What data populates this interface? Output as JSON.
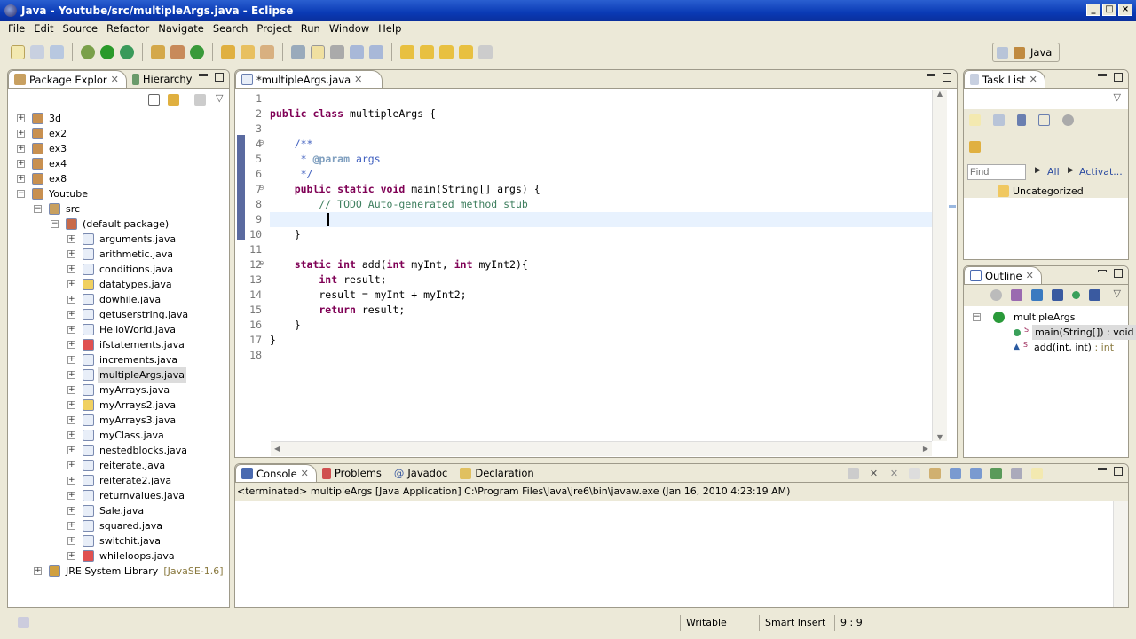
{
  "window": {
    "title": "Java - Youtube/src/multipleArgs.java - Eclipse"
  },
  "menu": [
    "File",
    "Edit",
    "Source",
    "Refactor",
    "Navigate",
    "Search",
    "Project",
    "Run",
    "Window",
    "Help"
  ],
  "perspective": {
    "label": "Java"
  },
  "left_panel": {
    "tabs": [
      "Package Explor",
      "Hierarchy"
    ],
    "tree": [
      {
        "label": "3d",
        "level": 0,
        "exp": "+",
        "icon": "project"
      },
      {
        "label": "ex2",
        "level": 0,
        "exp": "+",
        "icon": "project"
      },
      {
        "label": "ex3",
        "level": 0,
        "exp": "+",
        "icon": "project"
      },
      {
        "label": "ex4",
        "level": 0,
        "exp": "+",
        "icon": "project"
      },
      {
        "label": "ex8",
        "level": 0,
        "exp": "+",
        "icon": "project"
      },
      {
        "label": "Youtube",
        "level": 0,
        "exp": "-",
        "icon": "project"
      },
      {
        "label": "src",
        "level": 1,
        "exp": "-",
        "icon": "src"
      },
      {
        "label": "(default package)",
        "level": 2,
        "exp": "-",
        "icon": "package"
      },
      {
        "label": "arguments.java",
        "level": 3,
        "exp": "+",
        "icon": "java"
      },
      {
        "label": "arithmetic.java",
        "level": 3,
        "exp": "+",
        "icon": "java"
      },
      {
        "label": "conditions.java",
        "level": 3,
        "exp": "+",
        "icon": "java"
      },
      {
        "label": "datatypes.java",
        "level": 3,
        "exp": "+",
        "icon": "java-warn"
      },
      {
        "label": "dowhile.java",
        "level": 3,
        "exp": "+",
        "icon": "java"
      },
      {
        "label": "getuserstring.java",
        "level": 3,
        "exp": "+",
        "icon": "java"
      },
      {
        "label": "HelloWorld.java",
        "level": 3,
        "exp": "+",
        "icon": "java"
      },
      {
        "label": "ifstatements.java",
        "level": 3,
        "exp": "+",
        "icon": "java-error"
      },
      {
        "label": "increments.java",
        "level": 3,
        "exp": "+",
        "icon": "java"
      },
      {
        "label": "multipleArgs.java",
        "level": 3,
        "exp": "+",
        "icon": "java",
        "selected": true
      },
      {
        "label": "myArrays.java",
        "level": 3,
        "exp": "+",
        "icon": "java"
      },
      {
        "label": "myArrays2.java",
        "level": 3,
        "exp": "+",
        "icon": "java-warn"
      },
      {
        "label": "myArrays3.java",
        "level": 3,
        "exp": "+",
        "icon": "java"
      },
      {
        "label": "myClass.java",
        "level": 3,
        "exp": "+",
        "icon": "java"
      },
      {
        "label": "nestedblocks.java",
        "level": 3,
        "exp": "+",
        "icon": "java"
      },
      {
        "label": "reiterate.java",
        "level": 3,
        "exp": "+",
        "icon": "java"
      },
      {
        "label": "reiterate2.java",
        "level": 3,
        "exp": "+",
        "icon": "java"
      },
      {
        "label": "returnvalues.java",
        "level": 3,
        "exp": "+",
        "icon": "java"
      },
      {
        "label": "Sale.java",
        "level": 3,
        "exp": "+",
        "icon": "java"
      },
      {
        "label": "squared.java",
        "level": 3,
        "exp": "+",
        "icon": "java"
      },
      {
        "label": "switchit.java",
        "level": 3,
        "exp": "+",
        "icon": "java"
      },
      {
        "label": "whileloops.java",
        "level": 3,
        "exp": "+",
        "icon": "java-error"
      },
      {
        "label": "JRE System Library",
        "suffix": " [JavaSE-1.6]",
        "level": 1,
        "exp": "+",
        "icon": "library"
      }
    ]
  },
  "editor": {
    "tab": "*multipleArgs.java",
    "lines": [
      [],
      [
        [
          "kw",
          "public class "
        ],
        [
          "",
          "multipleArgs {"
        ]
      ],
      [],
      [
        [
          "jd",
          "    /**"
        ]
      ],
      [
        [
          "jd",
          "     * "
        ],
        [
          "tag",
          "@param"
        ],
        [
          "jd",
          " args"
        ]
      ],
      [
        [
          "jd",
          "     */"
        ]
      ],
      [
        [
          "kw",
          "    public static void "
        ],
        [
          "",
          "main(String[] args) {"
        ]
      ],
      [
        [
          "cm",
          "        // TODO Auto-generated method stub"
        ]
      ],
      [
        [
          "",
          "        "
        ]
      ],
      [
        [
          "",
          "    }"
        ]
      ],
      [],
      [
        [
          "kw",
          "    static int "
        ],
        [
          "",
          "add("
        ],
        [
          "kw",
          "int "
        ],
        [
          "",
          "myInt, "
        ],
        [
          "kw",
          "int "
        ],
        [
          "",
          "myInt2){"
        ]
      ],
      [
        [
          "kw",
          "        int "
        ],
        [
          "",
          "result;"
        ]
      ],
      [
        [
          "",
          "        result = myInt + myInt2;"
        ]
      ],
      [
        [
          "kw",
          "        return "
        ],
        [
          "",
          "result;"
        ]
      ],
      [
        [
          "",
          "    }"
        ]
      ],
      [
        [
          "",
          "}"
        ]
      ],
      []
    ]
  },
  "task_list": {
    "tab": "Task List",
    "find_placeholder": "Find",
    "filter_all": "All",
    "filter_activate": "Activat...",
    "category": "Uncategorized"
  },
  "outline": {
    "tab": "Outline",
    "class": "multipleArgs",
    "members": [
      {
        "name": "main(String[]) : void",
        "ret": ""
      },
      {
        "name": "add(int, int)",
        "ret": " : int"
      }
    ]
  },
  "console": {
    "tabs": [
      "Console",
      "Problems",
      "Javadoc",
      "Declaration"
    ],
    "status": "<terminated> multipleArgs [Java Application] C:\\Program Files\\Java\\jre6\\bin\\javaw.exe (Jan 16, 2010 4:23:19 AM)"
  },
  "statusbar": {
    "mode": "Writable",
    "insert": "Smart Insert",
    "position": "9 : 9"
  }
}
